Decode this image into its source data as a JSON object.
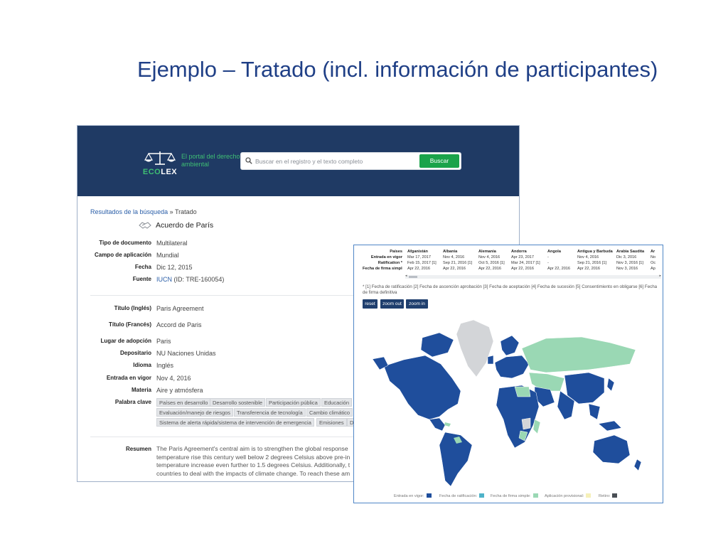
{
  "slide": {
    "title": "Ejemplo – Tratado (incl. información de participantes)"
  },
  "ecolex": {
    "logo": {
      "eco": "ECO",
      "lex": "LEX",
      "icon": "scales-icon"
    },
    "tagline": "El portal del derecho ambiental",
    "search": {
      "placeholder": "Buscar en el registro y el texto completo",
      "button": "Buscar",
      "icon": "search-icon"
    },
    "breadcrumb": {
      "link": "Resultados de la búsqueda",
      "separator": "»",
      "current": "Tratado"
    },
    "document_title": "Acuerdo de París",
    "document_icon": "handshake-icon",
    "fields": [
      {
        "label": "Tipo de documento",
        "value": "Multilateral"
      },
      {
        "label": "Campo de aplicación",
        "value": "Mundial"
      },
      {
        "label": "Fecha",
        "value": "Dic 12, 2015"
      },
      {
        "label": "Fuente",
        "value_link": "IUCN",
        "value": "(ID: TRE-160054)"
      },
      {
        "label": "Título (Inglés)",
        "value": "Paris Agreement"
      },
      {
        "label": "Título (Francés)",
        "value": "Accord de Paris"
      },
      {
        "label": "Lugar de adopción",
        "value": "Paris"
      },
      {
        "label": "Depositario",
        "value": "NU Naciones Unidas"
      },
      {
        "label": "Idioma",
        "value": "Inglés"
      },
      {
        "label": "Entrada en vigor",
        "value": "Nov 4, 2016"
      },
      {
        "label": "Materia",
        "value": "Aire y atmósfera"
      },
      {
        "label": "Palabra clave"
      },
      {
        "label": "Resumen"
      }
    ],
    "keywords": [
      "Países en desarrollo",
      "Desarrollo sostenible",
      "Participación pública",
      "Educación",
      "Evaluación/manejo de riesgos",
      "Transferencia de tecnología",
      "Cambio climático",
      "Sistema de alerta rápida/sistema de intervención de emergencia",
      "Emisiones",
      "D"
    ],
    "summary_lines": [
      "The Paris Agreement's central aim is to strengthen the global response",
      "temperature rise this century well below 2 degrees Celsius above pre-in",
      "temperature increase even further to 1.5 degrees Celsius. Additionally, t",
      "countries to deal with the impacts of climate change. To reach these am"
    ]
  },
  "participants": {
    "row_labels": [
      "Países",
      "Entrada en vigor",
      "Ratification *",
      "Fecha de firma simple"
    ],
    "columns": [
      {
        "country": "Afganistán",
        "entrada": "Mar 17, 2017",
        "ratificacion": "Feb 15, 2017 [1]",
        "firma": "Apr 22, 2016"
      },
      {
        "country": "Albania",
        "entrada": "Nov 4, 2016",
        "ratificacion": "Sep 21, 2016 [1]",
        "firma": "Apr 22, 2016"
      },
      {
        "country": "Alemania",
        "entrada": "Nov 4, 2016",
        "ratificacion": "Oct 5, 2016 [1]",
        "firma": "Apr 22, 2016"
      },
      {
        "country": "Andorra",
        "entrada": "Apr 23, 2017",
        "ratificacion": "Mar 24, 2017 [1]",
        "firma": "Apr 22, 2016"
      },
      {
        "country": "Angola",
        "entrada": "-",
        "ratificacion": "-",
        "firma": "Apr 22, 2016"
      },
      {
        "country": "Antigua y Barbuda",
        "entrada": "Nov 4, 2016",
        "ratificacion": "Sep 21, 2016 [1]",
        "firma": "Apr 22, 2016"
      },
      {
        "country": "Arabia Saudita",
        "entrada": "Dic 3, 2016",
        "ratificacion": "Nov 3, 2016 [1]",
        "firma": "Nov 3, 2016"
      },
      {
        "country": "Ar",
        "entrada": "No",
        "ratificacion": "Oc",
        "firma": "Ap"
      }
    ],
    "footnote": "* [1] Fecha de ratificación [2] Fecha de ascención aprobación [3] Fecha de aceptación [4] Fecha de sucesión [5] Consentimiento en obligarse [6] Fecha de firma definitiva",
    "buttons": [
      "reset",
      "zoom out",
      "zoom in"
    ],
    "legend": [
      {
        "label": "Entrada en vigor:",
        "color": "#1f4e9c"
      },
      {
        "label": "Fecha de ratificación:",
        "color": "#4fb3c9"
      },
      {
        "label": "Fecha de firma simple:",
        "color": "#9ad8b4"
      },
      {
        "label": "Aplicación provisional:",
        "color": "#f5f0b8"
      },
      {
        "label": "Retiro:",
        "color": "#4a4f55"
      }
    ],
    "map_colors": {
      "in_force": "#1f4e9c",
      "signed": "#9ad8b4",
      "none": "#d3d5d8"
    }
  }
}
